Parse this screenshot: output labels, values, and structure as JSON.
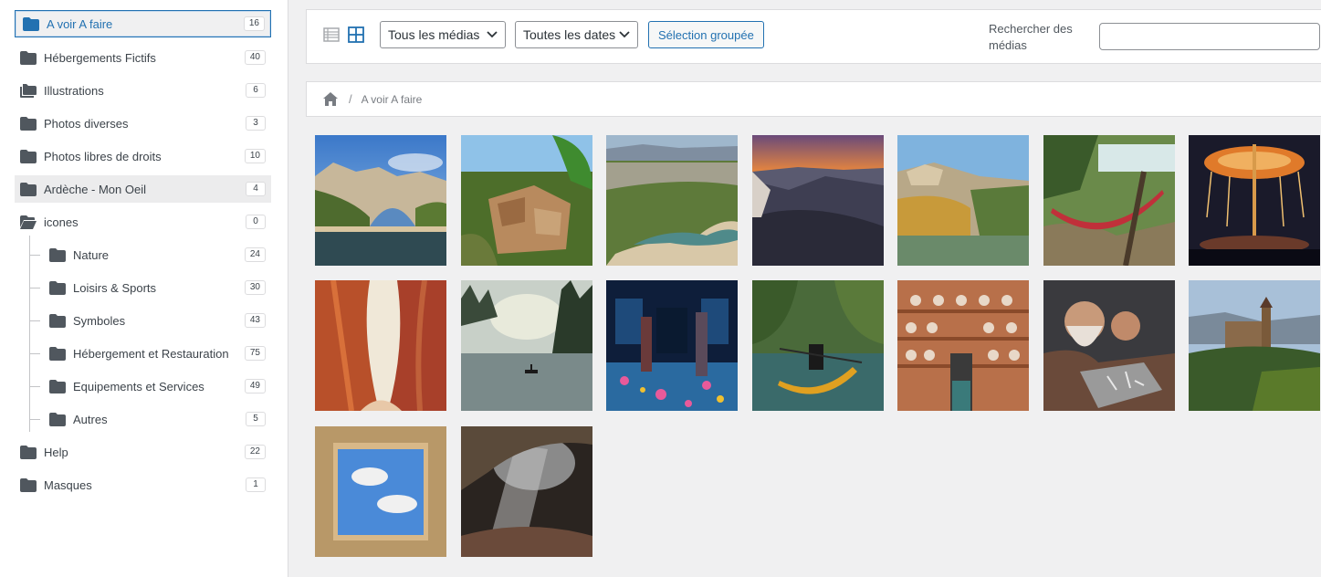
{
  "sidebar": {
    "folders": [
      {
        "label": "A voir A faire",
        "count": "16",
        "icon": "folder-icon"
      },
      {
        "label": "Hébergements Fictifs",
        "count": "40",
        "icon": "folder-icon"
      },
      {
        "label": "Illustrations",
        "count": "6",
        "icon": "folders-icon"
      },
      {
        "label": "Photos diverses",
        "count": "3",
        "icon": "folder-icon"
      },
      {
        "label": "Photos libres de droits",
        "count": "10",
        "icon": "folder-icon"
      },
      {
        "label": "Ardèche - Mon Oeil",
        "count": "4",
        "icon": "folder-icon"
      },
      {
        "label": "icones",
        "count": "0",
        "icon": "folder-open-icon"
      },
      {
        "label": "Nature",
        "count": "24",
        "icon": "folder-icon"
      },
      {
        "label": "Loisirs & Sports",
        "count": "30",
        "icon": "folder-icon"
      },
      {
        "label": "Symboles",
        "count": "43",
        "icon": "folder-icon"
      },
      {
        "label": "Hébergement et Restauration",
        "count": "75",
        "icon": "folder-icon"
      },
      {
        "label": "Equipements et Services",
        "count": "49",
        "icon": "folder-icon"
      },
      {
        "label": "Autres",
        "count": "5",
        "icon": "folder-icon"
      },
      {
        "label": "Help",
        "count": "22",
        "icon": "folder-icon"
      },
      {
        "label": "Masques",
        "count": "1",
        "icon": "folder-icon"
      }
    ]
  },
  "toolbar": {
    "filter_type": "Tous les médias",
    "filter_date": "Toutes les dates",
    "bulk_select": "Sélection groupée",
    "search_label": "Rechercher des médias",
    "search_value": ""
  },
  "breadcrumb": {
    "current": "A voir A faire"
  },
  "colors": {
    "accent": "#2271b1",
    "folder": "#50575e"
  }
}
